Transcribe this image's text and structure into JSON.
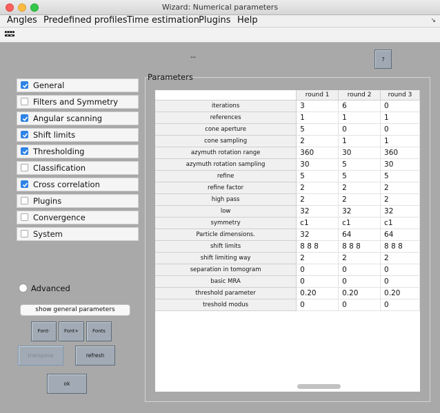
{
  "window": {
    "title": "Wizard: Numerical parameters"
  },
  "menubar": {
    "items": [
      "Angles",
      "Predefined profiles",
      "Time estimation",
      "Plugins",
      "Help"
    ],
    "corner": "↘"
  },
  "toolbar": {
    "icon": "toolbar-glyph-icon"
  },
  "header": {
    "dashes": "--",
    "help_label": "?"
  },
  "categories": [
    {
      "label": "General",
      "checked": true
    },
    {
      "label": "Filters and Symmetry",
      "checked": false
    },
    {
      "label": "Angular scanning",
      "checked": true
    },
    {
      "label": "Shift limits",
      "checked": true
    },
    {
      "label": "Thresholding",
      "checked": true
    },
    {
      "label": "Classification",
      "checked": false
    },
    {
      "label": "Cross correlation",
      "checked": true
    },
    {
      "label": "Plugins",
      "checked": false
    },
    {
      "label": "Convergence",
      "checked": false
    },
    {
      "label": "System",
      "checked": false
    }
  ],
  "advanced": {
    "label": "Advanced",
    "selected": false
  },
  "buttons": {
    "show_general": "show general parameters",
    "font_minus": "Font-",
    "font_plus": "Font+",
    "fonts": "Fonts",
    "transpose": "transpose",
    "refresh": "refresh",
    "ok": "ok"
  },
  "params": {
    "title": "Parameters",
    "columns": [
      "round 1",
      "round 2",
      "round 3"
    ],
    "rows": [
      {
        "name": "iterations",
        "values": [
          "3",
          "6",
          "0"
        ]
      },
      {
        "name": "references",
        "values": [
          "1",
          "1",
          "1"
        ]
      },
      {
        "name": "cone aperture",
        "values": [
          "5",
          "0",
          "0"
        ]
      },
      {
        "name": "cone sampling",
        "values": [
          "2",
          "1",
          "1"
        ]
      },
      {
        "name": "azymuth rotation range",
        "values": [
          "360",
          "30",
          "360"
        ]
      },
      {
        "name": "azymuth rotation sampling",
        "values": [
          "30",
          "5",
          "30"
        ]
      },
      {
        "name": "refine",
        "values": [
          "5",
          "5",
          "5"
        ]
      },
      {
        "name": "refine factor",
        "values": [
          "2",
          "2",
          "2"
        ]
      },
      {
        "name": "high pass",
        "values": [
          "2",
          "2",
          "2"
        ]
      },
      {
        "name": "low",
        "values": [
          "32",
          "32",
          "32"
        ]
      },
      {
        "name": "symmetry",
        "values": [
          "c1",
          "c1",
          "c1"
        ]
      },
      {
        "name": "Particle dimensions.",
        "values": [
          "32",
          "64",
          "64"
        ]
      },
      {
        "name": "shift limits",
        "values": [
          "8 8 8",
          "8 8 8",
          "8 8 8"
        ]
      },
      {
        "name": "shift limiting way",
        "values": [
          "2",
          "2",
          "2"
        ]
      },
      {
        "name": "separation in tomogram",
        "values": [
          "0",
          "0",
          "0"
        ]
      },
      {
        "name": "basic MRA",
        "values": [
          "0",
          "0",
          "0"
        ]
      },
      {
        "name": "threshold parameter",
        "values": [
          " 0.20",
          " 0.20",
          " 0.20"
        ]
      },
      {
        "name": "treshold modus",
        "values": [
          "0",
          "0",
          "0"
        ]
      }
    ]
  }
}
